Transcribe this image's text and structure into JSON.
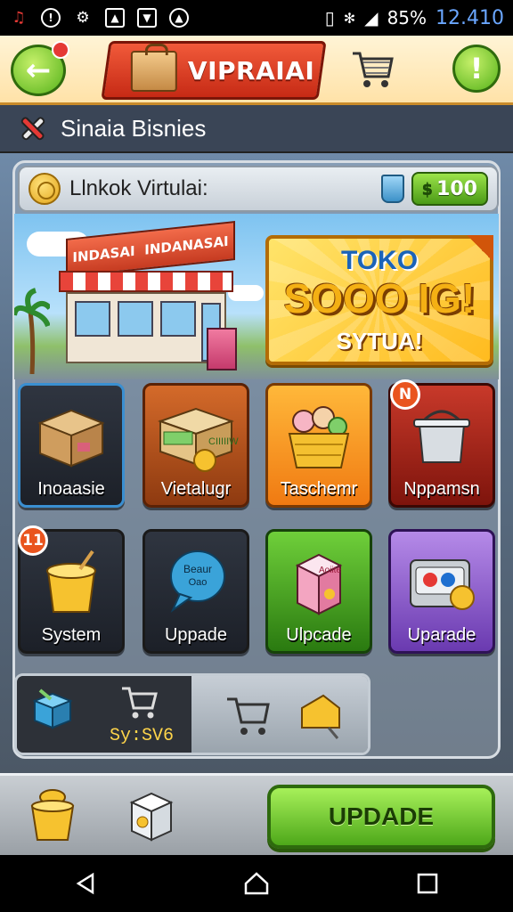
{
  "status_bar": {
    "battery": "85%",
    "time": "12.410"
  },
  "header": {
    "title": "VIPRAIAI"
  },
  "subheader": {
    "title": "Sinaia Bisnies"
  },
  "virtual_bar": {
    "label": "Llnkok Virtulai:",
    "cash": "100"
  },
  "shop": {
    "sign_left": "INDASAI",
    "sign_right": "INDANASAI"
  },
  "promo": {
    "line1": "TOKO",
    "line2": "SOOO IG!",
    "line3": "SYTUA!"
  },
  "tiles": [
    {
      "label": "Inoaasie"
    },
    {
      "label": "Vietalugr",
      "box_text": "CIIIIIW"
    },
    {
      "label": "Taschemr"
    },
    {
      "label": "Nppamsn",
      "badge": "N"
    },
    {
      "label": "System",
      "badge": "11"
    },
    {
      "label": "Uppade",
      "bubble_line1": "Beaur",
      "bubble_line2": "Oao"
    },
    {
      "label": "Ulpcade",
      "box_text": "Aoiite"
    },
    {
      "label": "Uparade"
    }
  ],
  "shopbar": {
    "code": "Sy:SV6"
  },
  "bottom": {
    "update_label": "UPDADE"
  },
  "colors": {
    "accent_green": "#4ea81a",
    "accent_red": "#c62a15",
    "promo_yellow": "#ffbb1f"
  }
}
